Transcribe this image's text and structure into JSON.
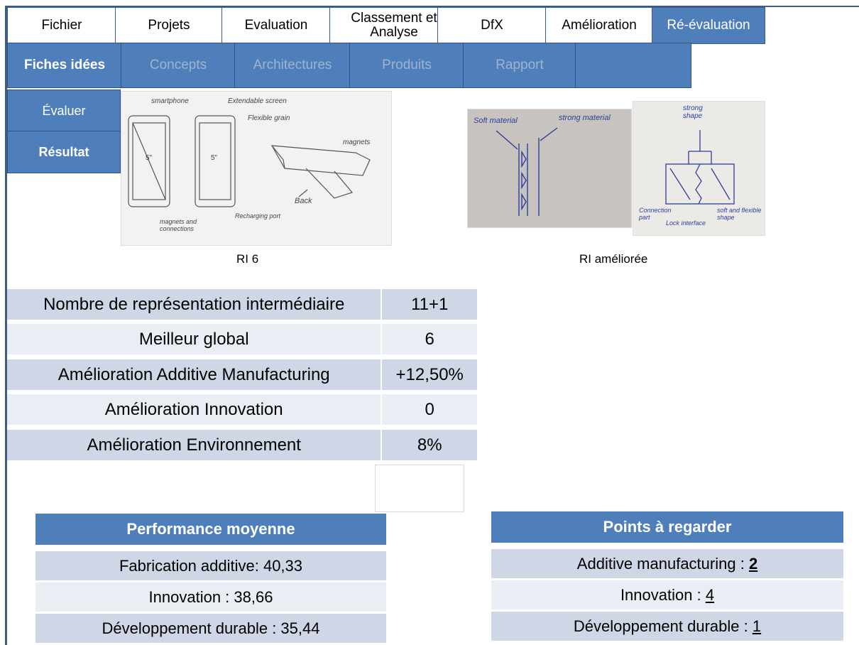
{
  "menu": [
    {
      "label": "Fichier",
      "active": false
    },
    {
      "label": "Projets",
      "active": false
    },
    {
      "label": "Evaluation",
      "active": false
    },
    {
      "label": "Classement et Analyse",
      "active": false
    },
    {
      "label": "DfX",
      "active": false
    },
    {
      "label": "Amélioration",
      "active": false
    },
    {
      "label": "Ré-évaluation",
      "active": true
    }
  ],
  "subtabs": [
    {
      "label": "Fiches idées",
      "active": true
    },
    {
      "label": "Concepts",
      "active": false
    },
    {
      "label": "Architectures",
      "active": false
    },
    {
      "label": "Produits",
      "active": false
    },
    {
      "label": "Rapport",
      "active": false
    },
    {
      "label": "",
      "active": false
    }
  ],
  "side": {
    "evaluate": "Évaluer",
    "result": "Résultat"
  },
  "images": {
    "ri6_caption": "RI 6",
    "ri6_labels": [
      "smartphone",
      "Extendable screen",
      "Flexible grain",
      "5\"",
      "5\"",
      "magnets",
      "Back",
      "magnets and connections",
      "Recharging port"
    ],
    "improved_caption": "RI améliorée",
    "improved_labels_a": [
      "Soft material",
      "strong material"
    ],
    "improved_labels_b": [
      "strong shape",
      "Connection part",
      "Lock interface",
      "soft and flexible shape"
    ]
  },
  "stats": [
    {
      "label": "Nombre de représentation intermédiaire",
      "value": "11+1"
    },
    {
      "label": "Meilleur global",
      "value": "6"
    },
    {
      "label": "Amélioration Additive Manufacturing",
      "value": "+12,50%"
    },
    {
      "label": "Amélioration Innovation",
      "value": "0"
    },
    {
      "label": "Amélioration Environnement",
      "value": "8%"
    }
  ],
  "performance": {
    "title": "Performance moyenne",
    "rows": [
      "Fabrication additive: 40,33",
      "Innovation : 38,66",
      "Développement durable : 35,44"
    ]
  },
  "points": {
    "title": "Points à regarder",
    "rows": [
      {
        "label": "Additive manufacturing : ",
        "value": "2"
      },
      {
        "label": "Innovation : ",
        "value": "4"
      },
      {
        "label": "Développement durable : ",
        "value": "1"
      }
    ]
  }
}
